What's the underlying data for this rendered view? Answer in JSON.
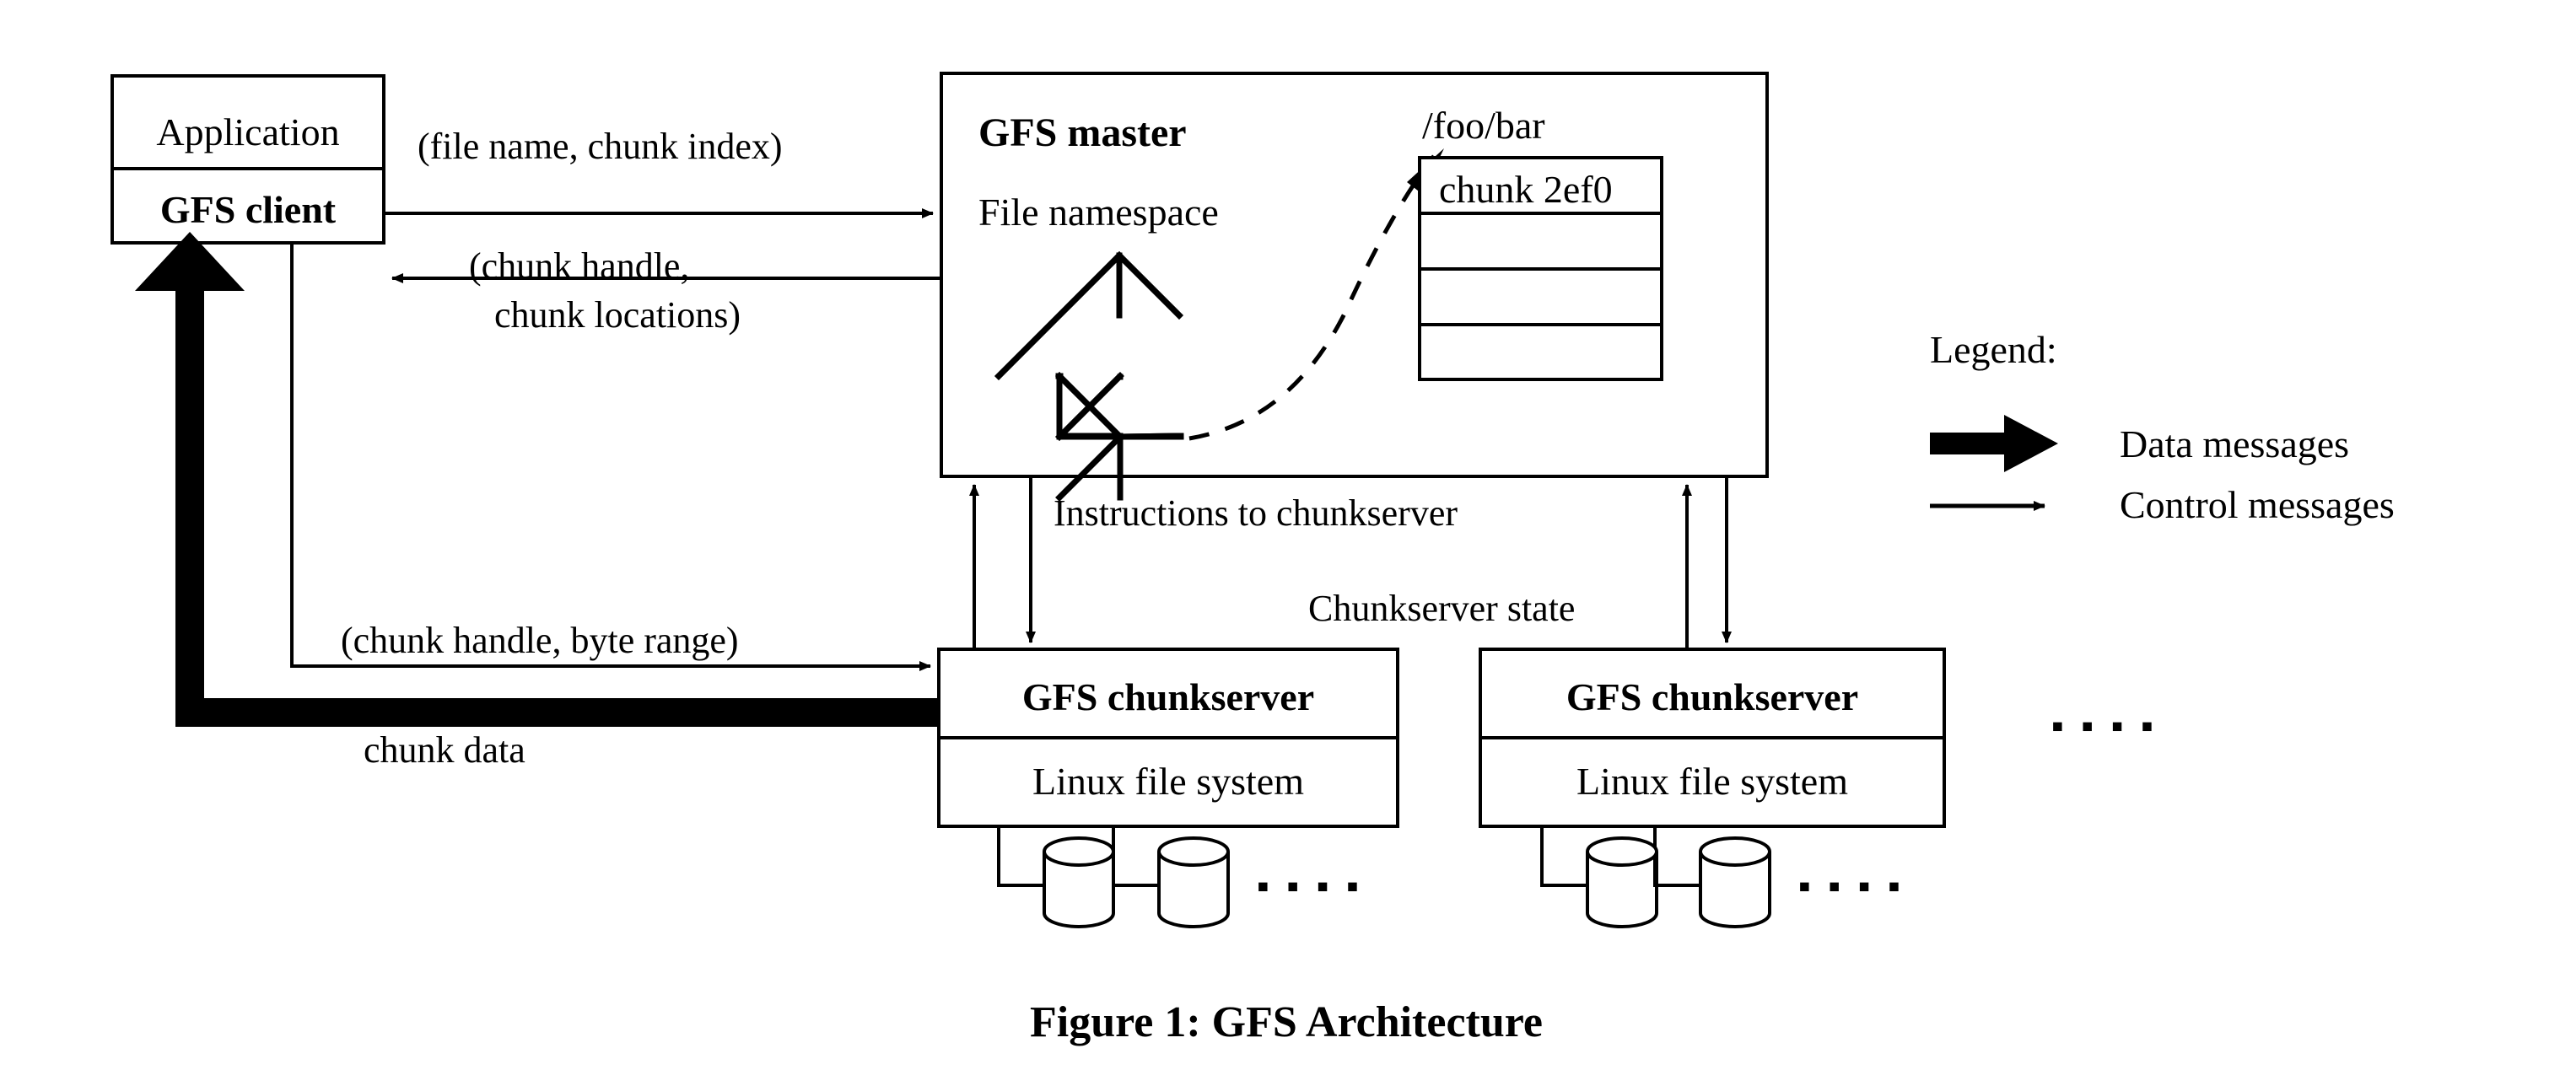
{
  "figure": {
    "caption": "Figure 1: GFS Architecture"
  },
  "client_stack": {
    "application_label": "Application",
    "gfs_client_label": "GFS client"
  },
  "master": {
    "title": "GFS master",
    "namespace_label": "File namespace",
    "file_path_label": "/foo/bar",
    "chunk_table": {
      "rows": [
        {
          "label": "chunk 2ef0"
        },
        {
          "label": ""
        },
        {
          "label": ""
        },
        {
          "label": ""
        }
      ]
    }
  },
  "chunkservers": [
    {
      "title": "GFS chunkserver",
      "filesystem_label": "Linux file system",
      "disk_count": 2,
      "ellipsis": "▪ ▪ ▪ ▪"
    },
    {
      "title": "GFS chunkserver",
      "filesystem_label": "Linux file system",
      "disk_count": 2,
      "ellipsis": "▪ ▪ ▪ ▪"
    }
  ],
  "more_chunkservers_ellipsis": "▪ ▪ ▪ ▪",
  "edge_labels": {
    "request": "(file name, chunk index)",
    "reply_line1": "(chunk handle,",
    "reply_line2": "chunk locations)",
    "instructions": "Instructions to chunkserver",
    "chunkserver_state": "Chunkserver state",
    "data_request": "(chunk handle, byte range)",
    "chunk_data": "chunk data"
  },
  "legend": {
    "title": "Legend:",
    "entries": [
      {
        "kind": "data",
        "label": "Data messages"
      },
      {
        "kind": "control",
        "label": "Control messages"
      }
    ]
  },
  "colors": {
    "stroke": "#000000",
    "fill": "#ffffff",
    "background": "#ffffff"
  }
}
